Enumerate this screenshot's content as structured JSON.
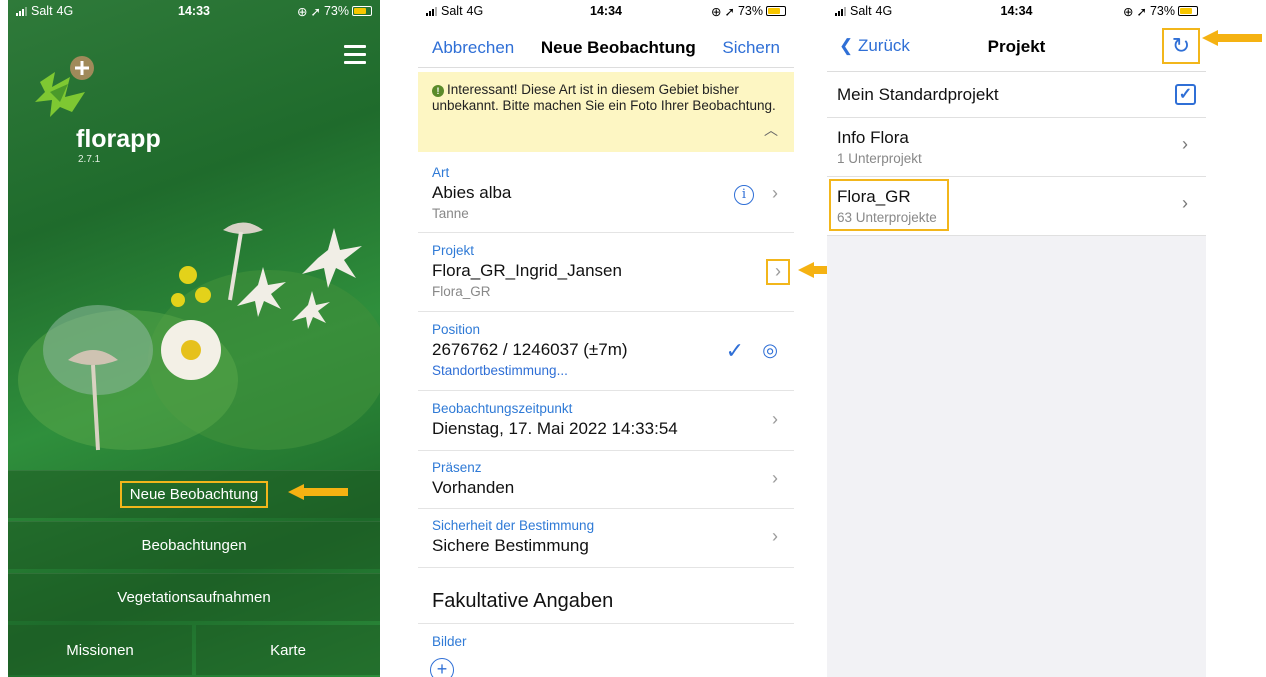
{
  "status_bars": [
    {
      "carrier": "Salt",
      "network": "4G",
      "time": "14:33",
      "battery": "73%"
    },
    {
      "carrier": "Salt",
      "network": "4G",
      "time": "14:34",
      "battery": "73%"
    },
    {
      "carrier": "Salt",
      "network": "4G",
      "time": "14:34",
      "battery": "73%"
    }
  ],
  "home": {
    "app_name": "florapp",
    "version": "2.7.1",
    "buttons": {
      "new_observation": "Neue Beobachtung",
      "observations": "Beobachtungen",
      "vegetation": "Vegetationsaufnahmen",
      "missions": "Missionen",
      "map": "Karte"
    }
  },
  "observation": {
    "nav": {
      "cancel": "Abbrechen",
      "title": "Neue Beobachtung",
      "save": "Sichern"
    },
    "banner": "Interessant! Diese Art ist in diesem Gebiet bisher unbekannt. Bitte machen Sie ein Foto Ihrer Beobachtung.",
    "fields": {
      "art": {
        "label": "Art",
        "value": "Abies alba",
        "sub": "Tanne"
      },
      "projekt": {
        "label": "Projekt",
        "value": "Flora_GR_Ingrid_Jansen",
        "sub": "Flora_GR"
      },
      "position": {
        "label": "Position",
        "value": "2676762 / 1246037 (±7m)",
        "sub": "Standortbestimmung..."
      },
      "zeitpunkt": {
        "label": "Beobachtungszeitpunkt",
        "value": "Dienstag, 17. Mai 2022 14:33:54"
      },
      "praesenz": {
        "label": "Präsenz",
        "value": "Vorhanden"
      },
      "sicherheit": {
        "label": "Sicherheit der Bestimmung",
        "value": "Sichere Bestimmung"
      }
    },
    "optional_header": "Fakultative Angaben",
    "images_label": "Bilder"
  },
  "project": {
    "nav": {
      "back": "Zurück",
      "title": "Projekt"
    },
    "items": [
      {
        "name": "Mein Standardprojekt",
        "sub": "",
        "checked": true
      },
      {
        "name": "Info Flora",
        "sub": "1 Unterprojekt"
      },
      {
        "name": "Flora_GR",
        "sub": "63 Unterprojekte"
      }
    ]
  },
  "colors": {
    "accent": "#2f6fd6",
    "highlight": "#f2b61b",
    "banner": "#fdf6c3"
  }
}
